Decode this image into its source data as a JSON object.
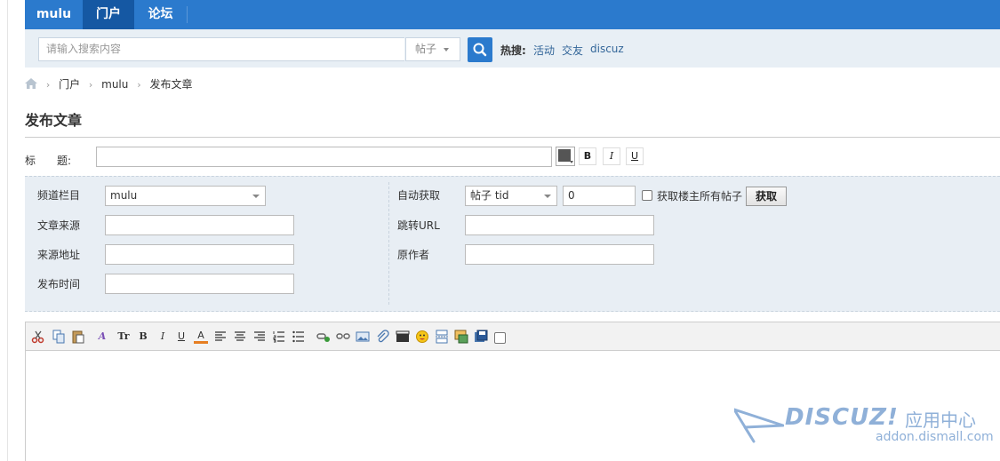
{
  "nav": {
    "items": [
      {
        "label": "mulu",
        "active": false
      },
      {
        "label": "门户",
        "active": true
      },
      {
        "label": "论坛",
        "active": false
      }
    ]
  },
  "search": {
    "placeholder": "请输入搜索内容",
    "type_label": "帖子",
    "hot_label": "热搜:",
    "hot_links": [
      "活动",
      "交友",
      "discuz"
    ]
  },
  "breadcrumb": [
    "门户",
    "mulu",
    "发布文章"
  ],
  "page_title": "发布文章",
  "title_row": {
    "label": "标　　题:",
    "bold_label": "B",
    "italic_label": "I",
    "underline_label": "U"
  },
  "meta": {
    "channel_label": "频道栏目",
    "channel_value": "mulu",
    "source_label": "文章来源",
    "source_url_label": "来源地址",
    "publish_time_label": "发布时间",
    "auto_fetch_label": "自动获取",
    "fetch_type_value": "帖子 tid",
    "fetch_tid_value": "0",
    "fetch_all_label": "获取楼主所有帖子",
    "fetch_button": "获取",
    "redirect_label": "跳转URL",
    "author_label": "原作者"
  },
  "toolbar_icons": [
    "cut-icon",
    "copy-icon",
    "paste-icon",
    "font-icon",
    "font-size-icon",
    "bold-icon",
    "italic-icon",
    "underline-icon",
    "font-color-icon",
    "align-left-icon",
    "align-center-icon",
    "align-right-icon",
    "ordered-list-icon",
    "unordered-list-icon",
    "link-icon",
    "unlink-icon",
    "image-icon",
    "attachment-icon",
    "video-icon",
    "emoticon-icon",
    "page-break-icon",
    "insert-icon",
    "save-icon",
    "checkbox"
  ],
  "watermark": {
    "logo": "DISCUZ!",
    "cn": "应用中心",
    "url": "addon.dismall.com"
  },
  "colors": {
    "nav_bg": "#2b7acd",
    "nav_active": "#1558a3",
    "panel_bg": "#e8eef4"
  }
}
